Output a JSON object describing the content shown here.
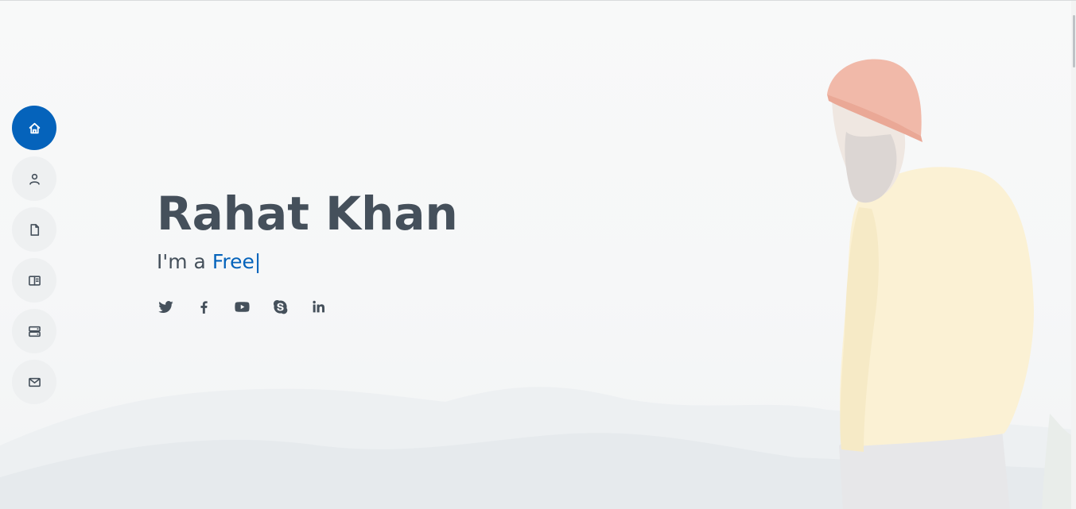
{
  "hero": {
    "name": "Rahat Khan",
    "tagline_prefix": "I'm a ",
    "typed_word": "Free",
    "typed_cursor": "|"
  },
  "nav": {
    "items": [
      {
        "icon": "home-icon",
        "active": true
      },
      {
        "icon": "person-icon",
        "active": false
      },
      {
        "icon": "file-icon",
        "active": false
      },
      {
        "icon": "book-icon",
        "active": false
      },
      {
        "icon": "server-icon",
        "active": false
      },
      {
        "icon": "envelope-icon",
        "active": false
      }
    ]
  },
  "social": [
    "twitter-icon",
    "facebook-icon",
    "youtube-icon",
    "skype-icon",
    "linkedin-icon"
  ],
  "colors": {
    "accent": "#0563bb",
    "text": "#45505b",
    "nav_bg": "#eef0f1",
    "background": "#f7f8f9"
  }
}
